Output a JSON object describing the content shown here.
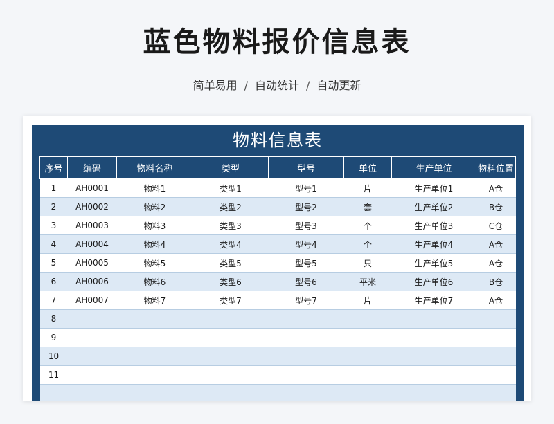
{
  "page": {
    "title": "蓝色物料报价信息表",
    "subtitle_parts": [
      "简单易用",
      "自动统计",
      "自动更新"
    ],
    "separator": "/"
  },
  "sheet": {
    "title": "物料信息表",
    "columns": [
      "序号",
      "编码",
      "物料名称",
      "类型",
      "型号",
      "单位",
      "生产单位",
      "物料位置"
    ],
    "rows": [
      {
        "seq": "1",
        "code": "AH0001",
        "name": "物料1",
        "type": "类型1",
        "model": "型号1",
        "unit": "片",
        "maker": "生产单位1",
        "location": "A仓"
      },
      {
        "seq": "2",
        "code": "AH0002",
        "name": "物料2",
        "type": "类型2",
        "model": "型号2",
        "unit": "套",
        "maker": "生产单位2",
        "location": "B仓"
      },
      {
        "seq": "3",
        "code": "AH0003",
        "name": "物料3",
        "type": "类型3",
        "model": "型号3",
        "unit": "个",
        "maker": "生产单位3",
        "location": "C仓"
      },
      {
        "seq": "4",
        "code": "AH0004",
        "name": "物料4",
        "type": "类型4",
        "model": "型号4",
        "unit": "个",
        "maker": "生产单位4",
        "location": "A仓"
      },
      {
        "seq": "5",
        "code": "AH0005",
        "name": "物料5",
        "type": "类型5",
        "model": "型号5",
        "unit": "只",
        "maker": "生产单位5",
        "location": "A仓"
      },
      {
        "seq": "6",
        "code": "AH0006",
        "name": "物料6",
        "type": "类型6",
        "model": "型号6",
        "unit": "平米",
        "maker": "生产单位6",
        "location": "B仓"
      },
      {
        "seq": "7",
        "code": "AH0007",
        "name": "物料7",
        "type": "类型7",
        "model": "型号7",
        "unit": "片",
        "maker": "生产单位7",
        "location": "A仓"
      },
      {
        "seq": "8",
        "code": "",
        "name": "",
        "type": "",
        "model": "",
        "unit": "",
        "maker": "",
        "location": ""
      },
      {
        "seq": "9",
        "code": "",
        "name": "",
        "type": "",
        "model": "",
        "unit": "",
        "maker": "",
        "location": ""
      },
      {
        "seq": "10",
        "code": "",
        "name": "",
        "type": "",
        "model": "",
        "unit": "",
        "maker": "",
        "location": ""
      },
      {
        "seq": "11",
        "code": "",
        "name": "",
        "type": "",
        "model": "",
        "unit": "",
        "maker": "",
        "location": ""
      },
      {
        "seq": "",
        "code": "",
        "name": "",
        "type": "",
        "model": "",
        "unit": "",
        "maker": "",
        "location": ""
      }
    ]
  },
  "colors": {
    "header_bg": "#1e4a76",
    "row_alt_bg": "#dde9f5",
    "page_bg": "#f4f6f9"
  }
}
